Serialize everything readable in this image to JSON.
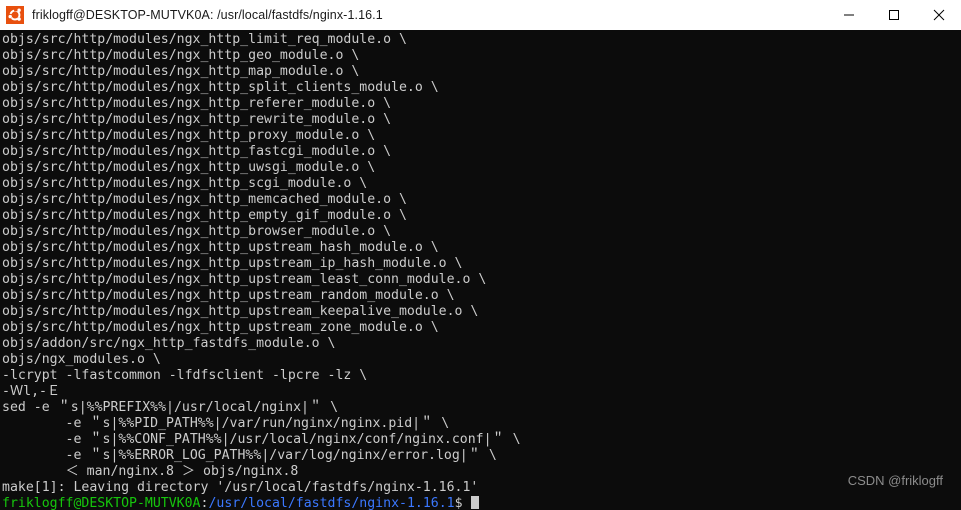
{
  "window": {
    "title": "friklogff@DESKTOP-MUTVK0A: /usr/local/fastdfs/nginx-1.16.1",
    "icon": "ubuntu-logo-icon",
    "controls": {
      "minimize": "minimize-icon",
      "maximize": "maximize-icon",
      "close": "close-icon"
    },
    "background_color": "#0c0c0c",
    "titlebar_color": "#ffffff"
  },
  "terminal": {
    "foreground_color": "#cccccc",
    "prompt_user_color": "#16c60c",
    "prompt_path_color": "#3b78ff",
    "lines": [
      "objs/src/http/modules/ngx_http_limit_req_module.o \\",
      "objs/src/http/modules/ngx_http_geo_module.o \\",
      "objs/src/http/modules/ngx_http_map_module.o \\",
      "objs/src/http/modules/ngx_http_split_clients_module.o \\",
      "objs/src/http/modules/ngx_http_referer_module.o \\",
      "objs/src/http/modules/ngx_http_rewrite_module.o \\",
      "objs/src/http/modules/ngx_http_proxy_module.o \\",
      "objs/src/http/modules/ngx_http_fastcgi_module.o \\",
      "objs/src/http/modules/ngx_http_uwsgi_module.o \\",
      "objs/src/http/modules/ngx_http_scgi_module.o \\",
      "objs/src/http/modules/ngx_http_memcached_module.o \\",
      "objs/src/http/modules/ngx_http_empty_gif_module.o \\",
      "objs/src/http/modules/ngx_http_browser_module.o \\",
      "objs/src/http/modules/ngx_http_upstream_hash_module.o \\",
      "objs/src/http/modules/ngx_http_upstream_ip_hash_module.o \\",
      "objs/src/http/modules/ngx_http_upstream_least_conn_module.o \\",
      "objs/src/http/modules/ngx_http_upstream_random_module.o \\",
      "objs/src/http/modules/ngx_http_upstream_keepalive_module.o \\",
      "objs/src/http/modules/ngx_http_upstream_zone_module.o \\",
      "objs/addon/src/ngx_http_fastdfs_module.o \\",
      "objs/ngx_modules.o \\",
      "-lcrypt -lfastcommon -lfdfsclient -lpcre -lz \\",
      "-Ｗl,-Ｅ",
      "sed -e ＂s|%%PREFIX%%|/usr/local/nginx|＂ \\",
      "        -e ＂s|%%PID_PATH%%|/var/run/nginx/nginx.pid|＂ \\",
      "        -e ＂s|%%CONF_PATH%%|/usr/local/nginx/conf/nginx.conf|＂ \\",
      "        -e ＂s|%%ERROR_LOG_PATH%%|/var/log/nginx/error.log|＂ \\",
      "        ＜ man/nginx.8 ＞ objs/nginx.8",
      "make[1]: Leaving directory '/usr/local/fastdfs/nginx-1.16.1'"
    ],
    "prompt": {
      "user_host": "friklogff@DESKTOP-MUTVK0A",
      "separator": ":",
      "path": "/usr/local/fastdfs/nginx-1.16.1",
      "symbol": "$",
      "cursor": "block-cursor"
    }
  },
  "watermark": {
    "text": "CSDN @friklogff"
  }
}
